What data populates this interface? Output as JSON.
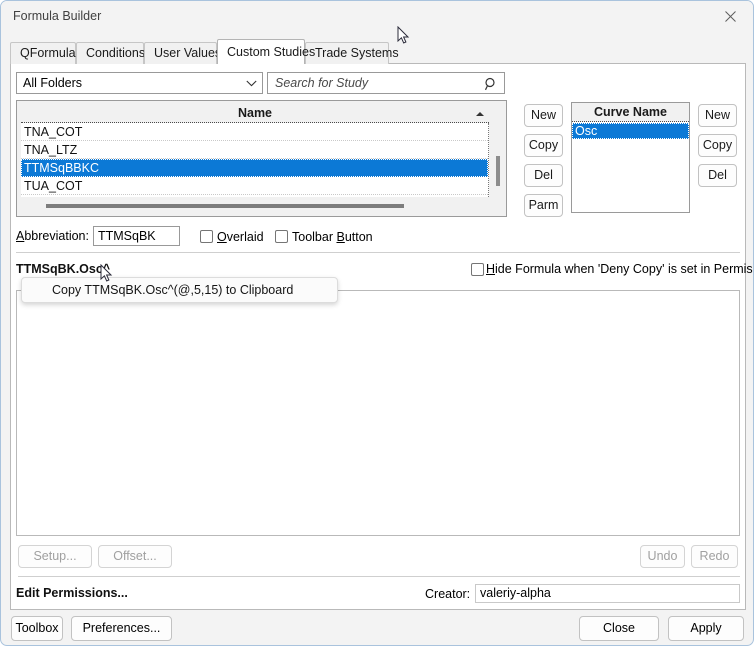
{
  "window": {
    "title": "Formula Builder",
    "close_icon": "close-icon",
    "accent": "#0c79d6",
    "border_color": "#a9c3dd"
  },
  "tabs": [
    {
      "label": "QFormulas",
      "active": false
    },
    {
      "label": "Conditions",
      "active": false
    },
    {
      "label": "User Values",
      "active": false
    },
    {
      "label": "Custom Studies",
      "active": true
    },
    {
      "label": "Trade Systems",
      "active": false
    }
  ],
  "toolbar": {
    "folder_filter": {
      "value": "All Folders",
      "icon": "chevron-down-icon"
    },
    "search": {
      "placeholder": "Search for Study",
      "value": "",
      "icon": "search-icon"
    }
  },
  "study_list": {
    "column_header": "Name",
    "sort_direction": "ascending",
    "rows": [
      {
        "name": "TNA_COT",
        "selected": false
      },
      {
        "name": "TNA_LTZ",
        "selected": false
      },
      {
        "name": "TTMSqBBKC",
        "selected": true
      },
      {
        "name": "TUA_COT",
        "selected": false
      }
    ]
  },
  "study_buttons": [
    {
      "label": "New"
    },
    {
      "label": "Copy"
    },
    {
      "label": "Del"
    },
    {
      "label": "Parm"
    }
  ],
  "curve_list": {
    "column_header": "Curve Name",
    "rows": [
      {
        "name": "Osc",
        "selected": true
      }
    ]
  },
  "curve_buttons": [
    {
      "label": "New"
    },
    {
      "label": "Copy"
    },
    {
      "label": "Del"
    }
  ],
  "abbreviation": {
    "label": "Abbreviation:",
    "value": "TTMSqBK"
  },
  "options": {
    "overlaid": {
      "label": "Overlaid",
      "checked": false
    },
    "toolbar_button": {
      "label": "Toolbar Button",
      "checked": false
    },
    "hide_formula": {
      "label": "Hide Formula when 'Deny Copy' is set in Permissions",
      "checked": false
    }
  },
  "formula": {
    "name": "TTMSqBK.Osc^",
    "body": ""
  },
  "tooltip": {
    "text": "Copy TTMSqBK.Osc^(@,5,15) to Clipboard"
  },
  "editor_toolbar": {
    "setup": {
      "label": "Setup...",
      "disabled": true
    },
    "offset": {
      "label": "Offset...",
      "disabled": true
    },
    "undo": {
      "label": "Undo",
      "disabled": true
    },
    "redo": {
      "label": "Redo",
      "disabled": true
    }
  },
  "permissions": {
    "edit_link": "Edit Permissions...",
    "creator_label": "Creator:",
    "creator_value": "valeriy-alpha"
  },
  "footer": {
    "toolbox": "Toolbox",
    "preferences": "Preferences...",
    "close": "Close",
    "apply": "Apply"
  }
}
